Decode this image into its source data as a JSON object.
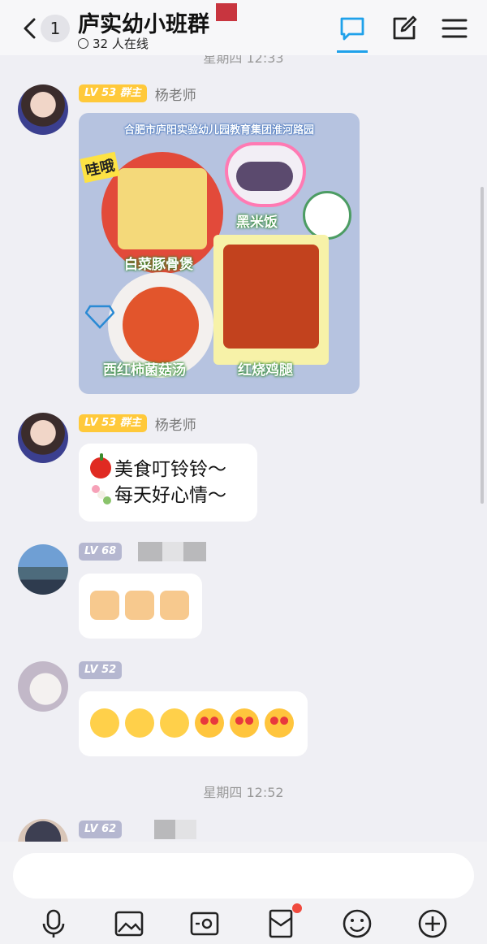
{
  "header": {
    "unread_count": "1",
    "title": "庐实幼小班群",
    "online": "32 人在线"
  },
  "timestamps": {
    "top": "星期四 12:33",
    "bottom": "星期四 12:52"
  },
  "messages": [
    {
      "level": "LV 53",
      "role": "群主",
      "name": "杨老师",
      "type": "image",
      "image": {
        "caption": "合肥市庐阳实验幼儿园教育集团淮河路园",
        "tag": "哇哦",
        "dishes": [
          "白菜豚骨煲",
          "黑米饭",
          "西红柿菌菇汤",
          "红烧鸡腿"
        ]
      }
    },
    {
      "level": "LV 53",
      "role": "群主",
      "name": "杨老师",
      "type": "text",
      "lines": [
        "美食叮铃铃～",
        "每天好心情～"
      ]
    },
    {
      "level": "LV 68",
      "type": "emoji",
      "emojis": [
        "thumbs-up",
        "thumbs-up",
        "thumbs-up"
      ]
    },
    {
      "level": "LV 52",
      "type": "emoji",
      "emojis": [
        "smile",
        "smile",
        "smile",
        "heart-eyes",
        "heart-eyes",
        "heart-eyes"
      ]
    },
    {
      "level": "LV 62",
      "type": "partial"
    }
  ],
  "toolbar": [
    "mic-icon",
    "image-icon",
    "camera-icon",
    "red-packet-icon",
    "emoji-icon",
    "plus-icon"
  ],
  "colors": {
    "accent": "#1fa1ea",
    "level_gold": "#ffc93a",
    "level_grey": "#b5b7d0",
    "badge_red": "#f04a3e"
  }
}
